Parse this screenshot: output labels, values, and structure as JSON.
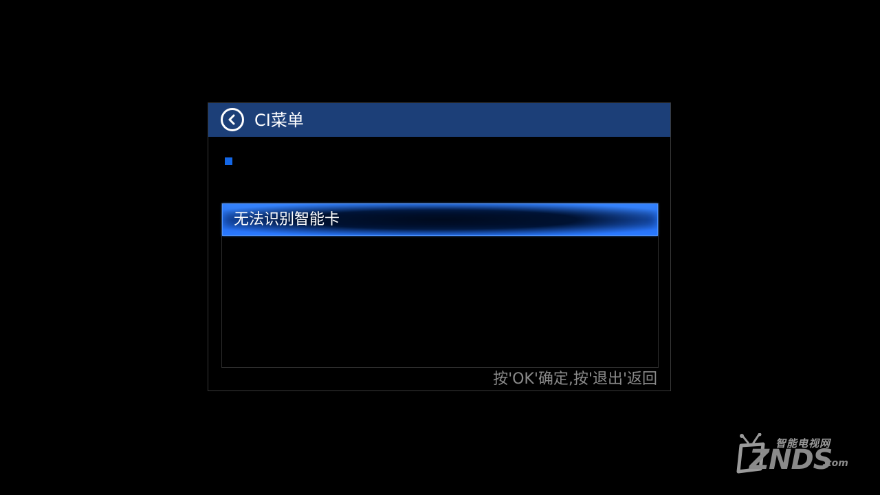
{
  "dialog": {
    "title": "CI菜单",
    "back_icon": "chevron-left-circle-icon",
    "accent_color": "#1c3f78",
    "indicator_color": "#1467e6",
    "items": [
      {
        "label": "无法识别智能卡",
        "selected": true
      }
    ],
    "hint": "按'OK'确定,按'退出'返回"
  },
  "watermark": {
    "top_text": "智能电视网",
    "brand": "ZNDS",
    "suffix": ".com"
  }
}
